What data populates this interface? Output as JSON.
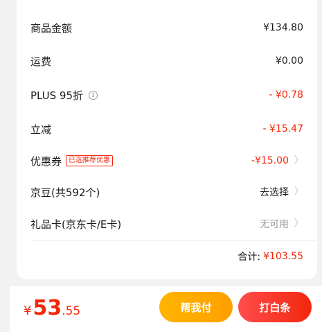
{
  "summary": {
    "rows": [
      {
        "label": "商品金额",
        "value": "¥134.80"
      },
      {
        "label": "运费",
        "value": "¥0.00"
      },
      {
        "label": "PLUS 95折",
        "value": "- ¥0.78",
        "info_icon": "info-icon"
      },
      {
        "label": "立减",
        "value": "- ¥15.47"
      },
      {
        "label": "优惠券",
        "tag": "已选推荐优惠",
        "value": "-¥15.00"
      },
      {
        "label": "京豆(共592个)",
        "value": "去选择"
      },
      {
        "label": "礼品卡(京东卡/E卡)",
        "value": "无可用"
      }
    ],
    "total_label": "合计:",
    "total_value": "¥103.55"
  },
  "bottom_bar": {
    "price_symbol": "¥",
    "price_integer": "53",
    "price_decimal": ".55",
    "help_pay_label": "帮我付",
    "iou_label": "打白条"
  },
  "colors": {
    "accent_red": "#f2270c",
    "help_button": "#ffb400",
    "background": "#f2f2f2"
  }
}
